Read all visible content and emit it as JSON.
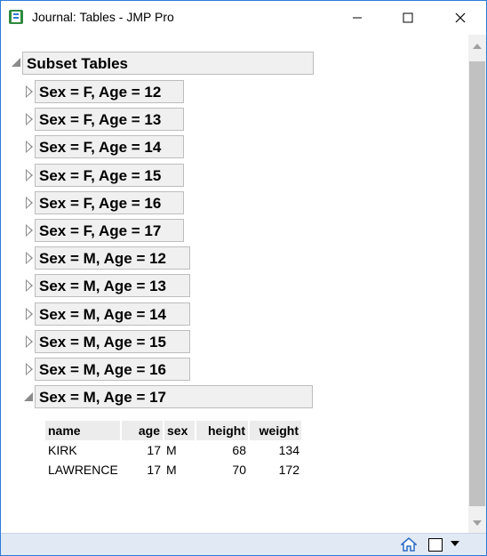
{
  "window": {
    "title": "Journal: Tables - JMP Pro"
  },
  "root": {
    "label": "Subset Tables"
  },
  "subsets": [
    "Sex = F, Age = 12",
    "Sex = F, Age = 13",
    "Sex = F, Age = 14",
    "Sex = F, Age = 15",
    "Sex = F, Age = 16",
    "Sex = F, Age = 17",
    "Sex = M, Age = 12",
    "Sex = M, Age = 13",
    "Sex = M, Age = 14",
    "Sex = M, Age = 15",
    "Sex = M, Age = 16",
    "Sex = M, Age = 17"
  ],
  "table": {
    "columns": [
      "name",
      "age",
      "sex",
      "height",
      "weight"
    ],
    "rows": [
      [
        "KIRK",
        "17",
        "M",
        "68",
        "134"
      ],
      [
        "LAWRENCE",
        "17",
        "M",
        "70",
        "172"
      ]
    ]
  },
  "colors": {
    "accent": "#2b7bd8",
    "status_bar": "#e1e9f4",
    "header_bg": "#f0f0f0"
  },
  "icons": {
    "app": "jmp-journal-icon",
    "home": "home-icon",
    "layout": "window-layout-icon",
    "menu": "dropdown-arrow-icon"
  }
}
